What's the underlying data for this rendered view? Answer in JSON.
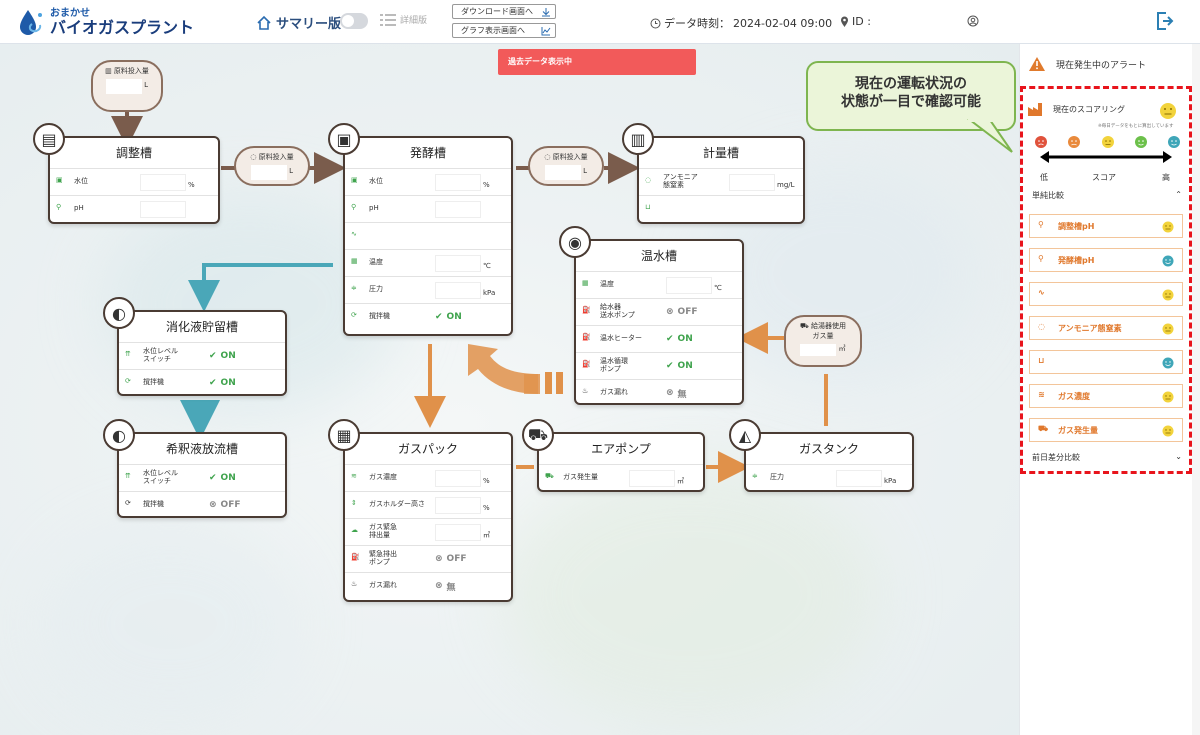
{
  "header": {
    "logo_sub": "おまかせ",
    "logo_main": "バイオガスプラント",
    "summary_label": "サマリー版",
    "detail_label": "詳細版",
    "download_btn": "ダウンロード画面へ",
    "graph_btn": "グラフ表示画面へ",
    "data_time_label": "データ時刻：",
    "data_time_value": "2024-02-04 09:00",
    "id_label": "ID :"
  },
  "banner": {
    "past_data": "過去データ表示中"
  },
  "callout": {
    "line1": "現在の運転状況の",
    "line2": "状態が一目で確認可能"
  },
  "bubbles": {
    "input_top": {
      "label": "原料投入量",
      "unit": "L"
    },
    "input_mid1": {
      "label": "原料投入量",
      "unit": "L"
    },
    "input_mid2": {
      "label": "原料投入量",
      "unit": "L"
    },
    "hot_gas": {
      "label1": "給湯器使用",
      "label2": "ガス量",
      "unit": "㎥"
    }
  },
  "cards": {
    "chosei": {
      "title": "調整槽",
      "rows": [
        {
          "label": "水位",
          "unit": "%"
        },
        {
          "label": "pH",
          "unit": ""
        }
      ]
    },
    "hakko": {
      "title": "発酵槽",
      "rows": [
        {
          "label": "水位",
          "unit": "%"
        },
        {
          "label": "pH",
          "unit": ""
        },
        {
          "label": "",
          "unit": ""
        },
        {
          "label": "温度",
          "unit": "℃"
        },
        {
          "label": "圧力",
          "unit": "kPa"
        },
        {
          "label": "撹拌機",
          "status": "ON"
        }
      ]
    },
    "keiryo": {
      "title": "計量槽",
      "rows": [
        {
          "label1": "アンモニア",
          "label2": "態窒素",
          "unit": "mg/L"
        },
        {
          "label": "",
          "unit": ""
        }
      ]
    },
    "onsui": {
      "title": "温水槽",
      "rows": [
        {
          "label": "温度",
          "unit": "℃"
        },
        {
          "label1": "給水器",
          "label2": "送水ポンプ",
          "status": "OFF"
        },
        {
          "label": "温水ヒーター",
          "status": "ON"
        },
        {
          "label1": "温水循環",
          "label2": "ポンプ",
          "status": "ON"
        },
        {
          "label": "ガス漏れ",
          "status": "無"
        }
      ]
    },
    "shoka": {
      "title": "消化液貯留槽",
      "rows": [
        {
          "label1": "水位レベル",
          "label2": "スイッチ",
          "status": "ON"
        },
        {
          "label": "撹拌機",
          "status": "ON"
        }
      ]
    },
    "kishaku": {
      "title": "希釈液放流槽",
      "rows": [
        {
          "label1": "水位レベル",
          "label2": "スイッチ",
          "status": "ON"
        },
        {
          "label": "撹拌機",
          "status": "OFF"
        }
      ]
    },
    "gaspack": {
      "title": "ガスパック",
      "rows": [
        {
          "label": "ガス濃度",
          "unit": "%"
        },
        {
          "label": "ガスホルダー高さ",
          "unit": "%"
        },
        {
          "label1": "ガス緊急",
          "label2": "排出量",
          "unit": "㎥"
        },
        {
          "label1": "緊急排出",
          "label2": "ポンプ",
          "status": "OFF"
        },
        {
          "label": "ガス漏れ",
          "status": "無"
        }
      ]
    },
    "airpump": {
      "title": "エアポンプ",
      "rows": [
        {
          "label": "ガス発生量",
          "unit": "㎥"
        }
      ]
    },
    "gastank": {
      "title": "ガスタンク",
      "rows": [
        {
          "label": "圧力",
          "unit": "kPa"
        }
      ]
    }
  },
  "sidebar": {
    "alert_title": "現在発生中のアラート",
    "scoring_title": "現在のスコアリング",
    "scoring_note": "※毎日データをもとに算出しています",
    "scale_low": "低",
    "scale_mid": "スコア",
    "scale_high": "高",
    "simple_compare": "単純比較",
    "prev_compare": "前日差分比較",
    "items": [
      {
        "label": "調整槽pH",
        "icon": "ph-icon",
        "face": "yellow"
      },
      {
        "label": "発酵槽pH",
        "icon": "ph-icon",
        "face": "teal"
      },
      {
        "label": "",
        "icon": "wave-icon",
        "face": "yellow"
      },
      {
        "label": "アンモニア態窒素",
        "icon": "drop-icon",
        "face": "yellow"
      },
      {
        "label": "",
        "icon": "beaker-icon",
        "face": "teal"
      },
      {
        "label": "ガス濃度",
        "icon": "gas-icon",
        "face": "yellow"
      },
      {
        "label": "ガス発生量",
        "icon": "truck-icon",
        "face": "yellow"
      }
    ]
  },
  "colors": {
    "brown": "#4a3b33",
    "arrow_brown": "#7a5c4c",
    "orange": "#e0914a",
    "teal": "#4aa7b8",
    "green": "#3fa34d",
    "red": "#e8141c"
  }
}
